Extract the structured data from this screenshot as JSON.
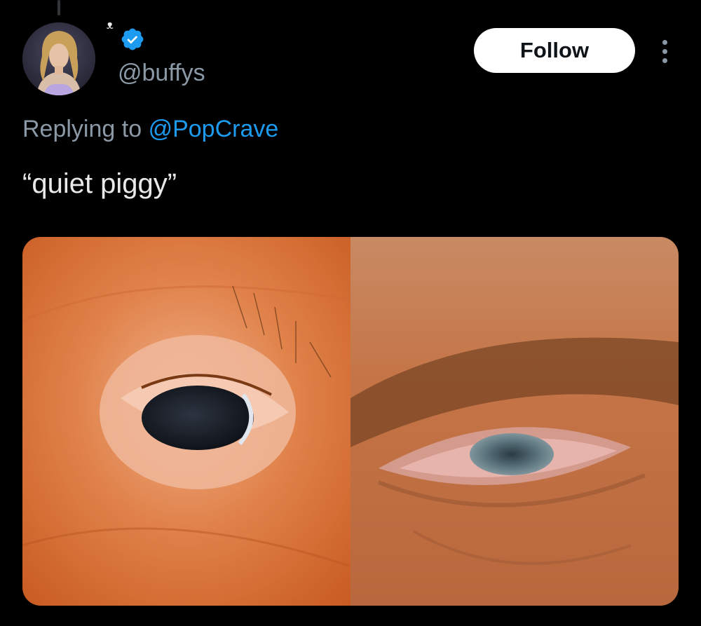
{
  "author": {
    "display_name": "ᵜ",
    "handle": "@buffys",
    "verified": true
  },
  "follow_button": {
    "label": "Follow"
  },
  "more_icon": "more-horizontal-icon",
  "reply": {
    "prefix": "Replying to",
    "target": "@PopCrave"
  },
  "tweet": {
    "text": "“quiet piggy”"
  },
  "colors": {
    "background": "#000000",
    "text": "#e7e9ea",
    "secondary_text": "#8b98a5",
    "accent": "#1d9bf0",
    "button_bg": "#ffffff",
    "button_text": "#0f1419"
  }
}
